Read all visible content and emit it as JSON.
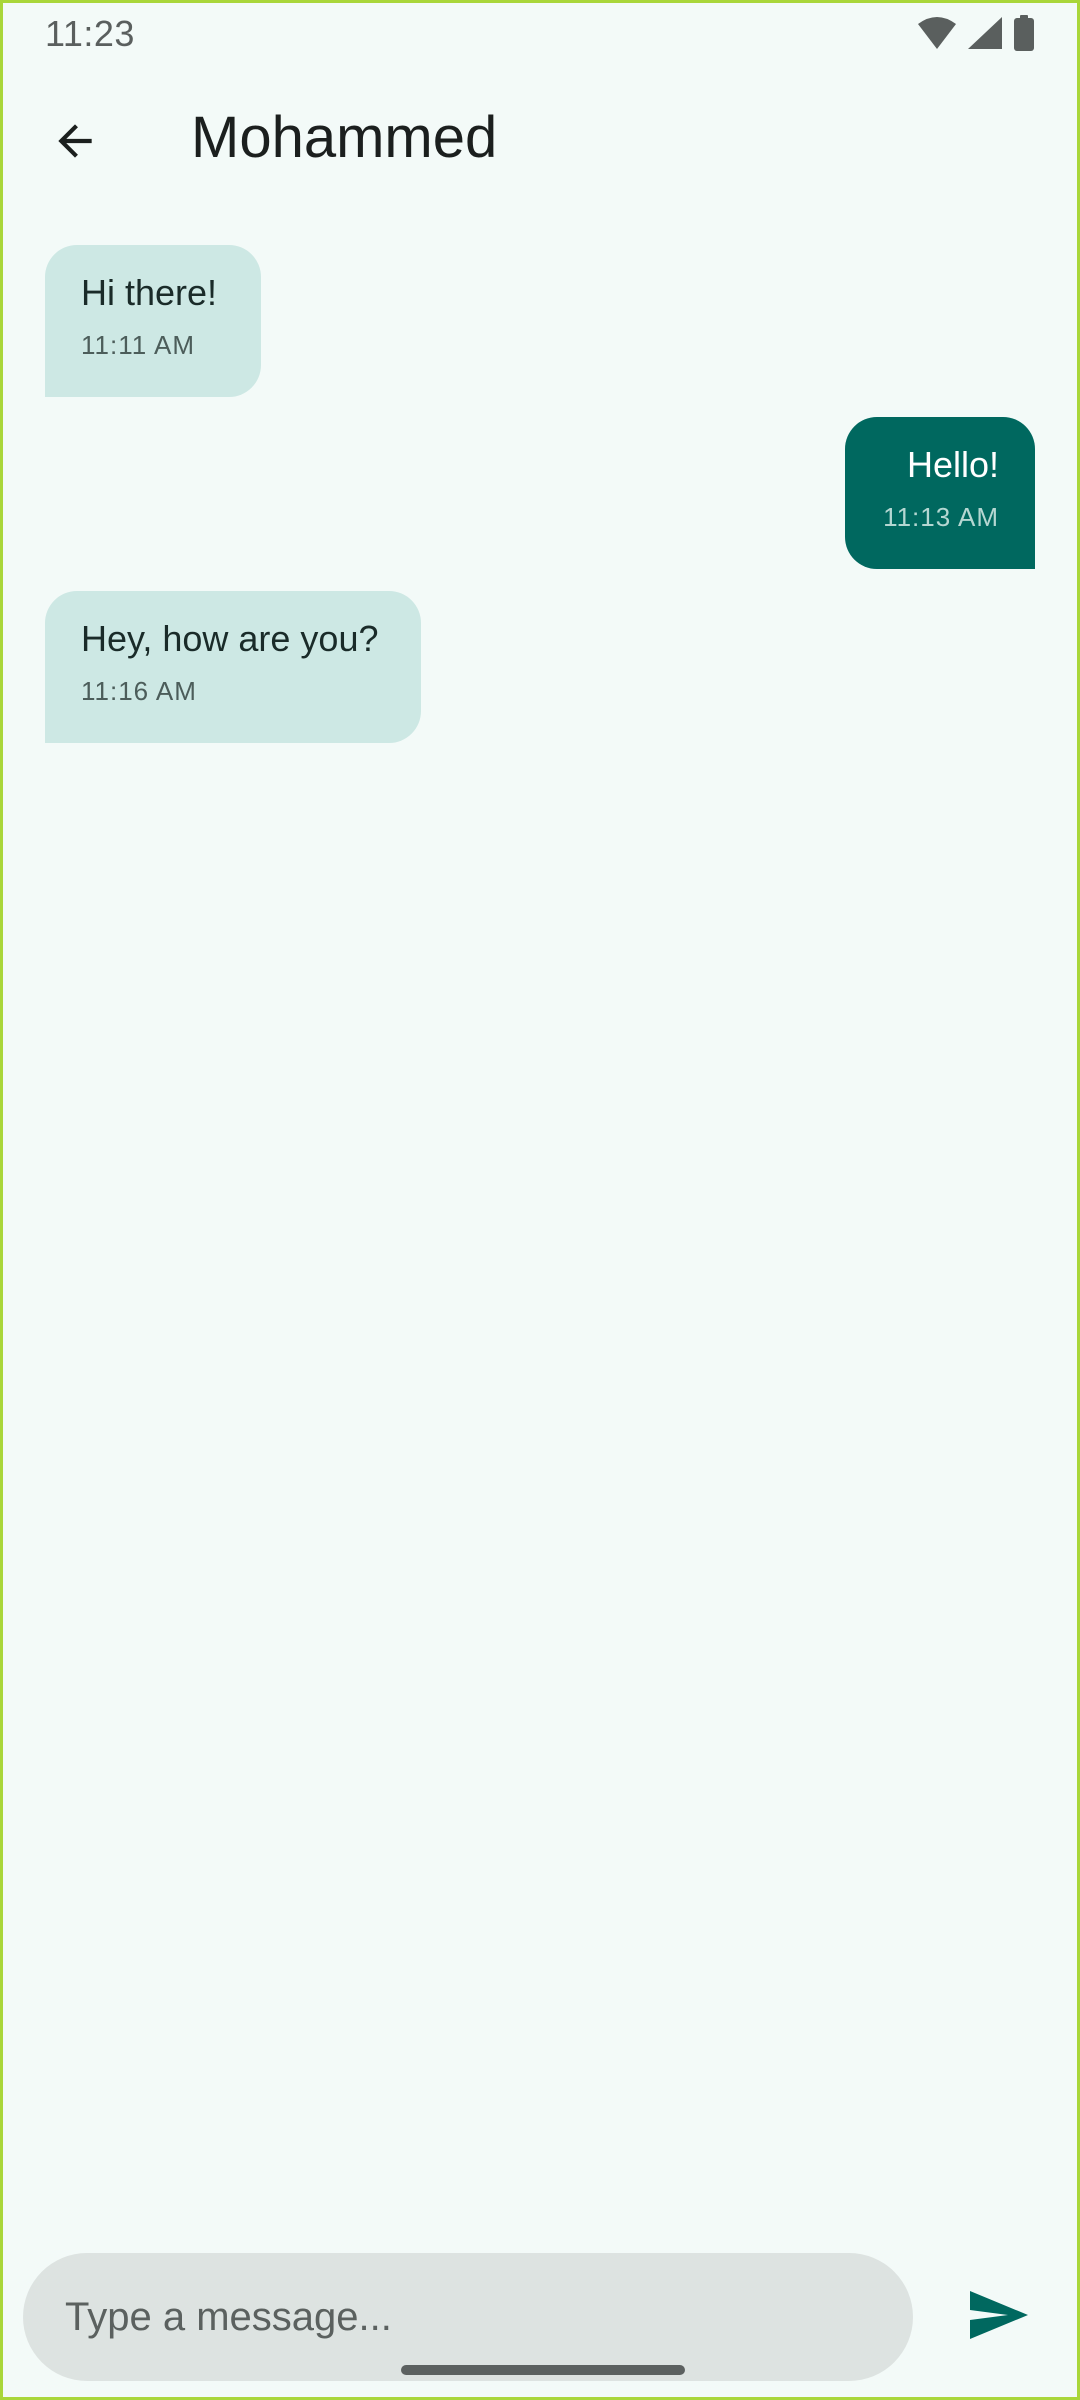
{
  "status_bar": {
    "time": "11:23",
    "icons": [
      "wifi-icon",
      "cellular-signal-icon",
      "battery-icon"
    ]
  },
  "app_bar": {
    "back_icon": "arrow-back-icon",
    "title": "Mohammed"
  },
  "messages": [
    {
      "direction": "incoming",
      "text": "Hi there!",
      "time": "11:11 AM"
    },
    {
      "direction": "outgoing",
      "text": "Hello!",
      "time": "11:13 AM"
    },
    {
      "direction": "incoming",
      "text": "Hey, how are you?",
      "time": "11:16 AM"
    }
  ],
  "composer": {
    "placeholder": "Type a message...",
    "value": "",
    "send_icon": "send-icon"
  },
  "colors": {
    "background": "#f3faf8",
    "incoming_bubble": "#cde8e4",
    "outgoing_bubble": "#00685f",
    "input_background": "#dde3e1",
    "accent": "#00685f"
  }
}
